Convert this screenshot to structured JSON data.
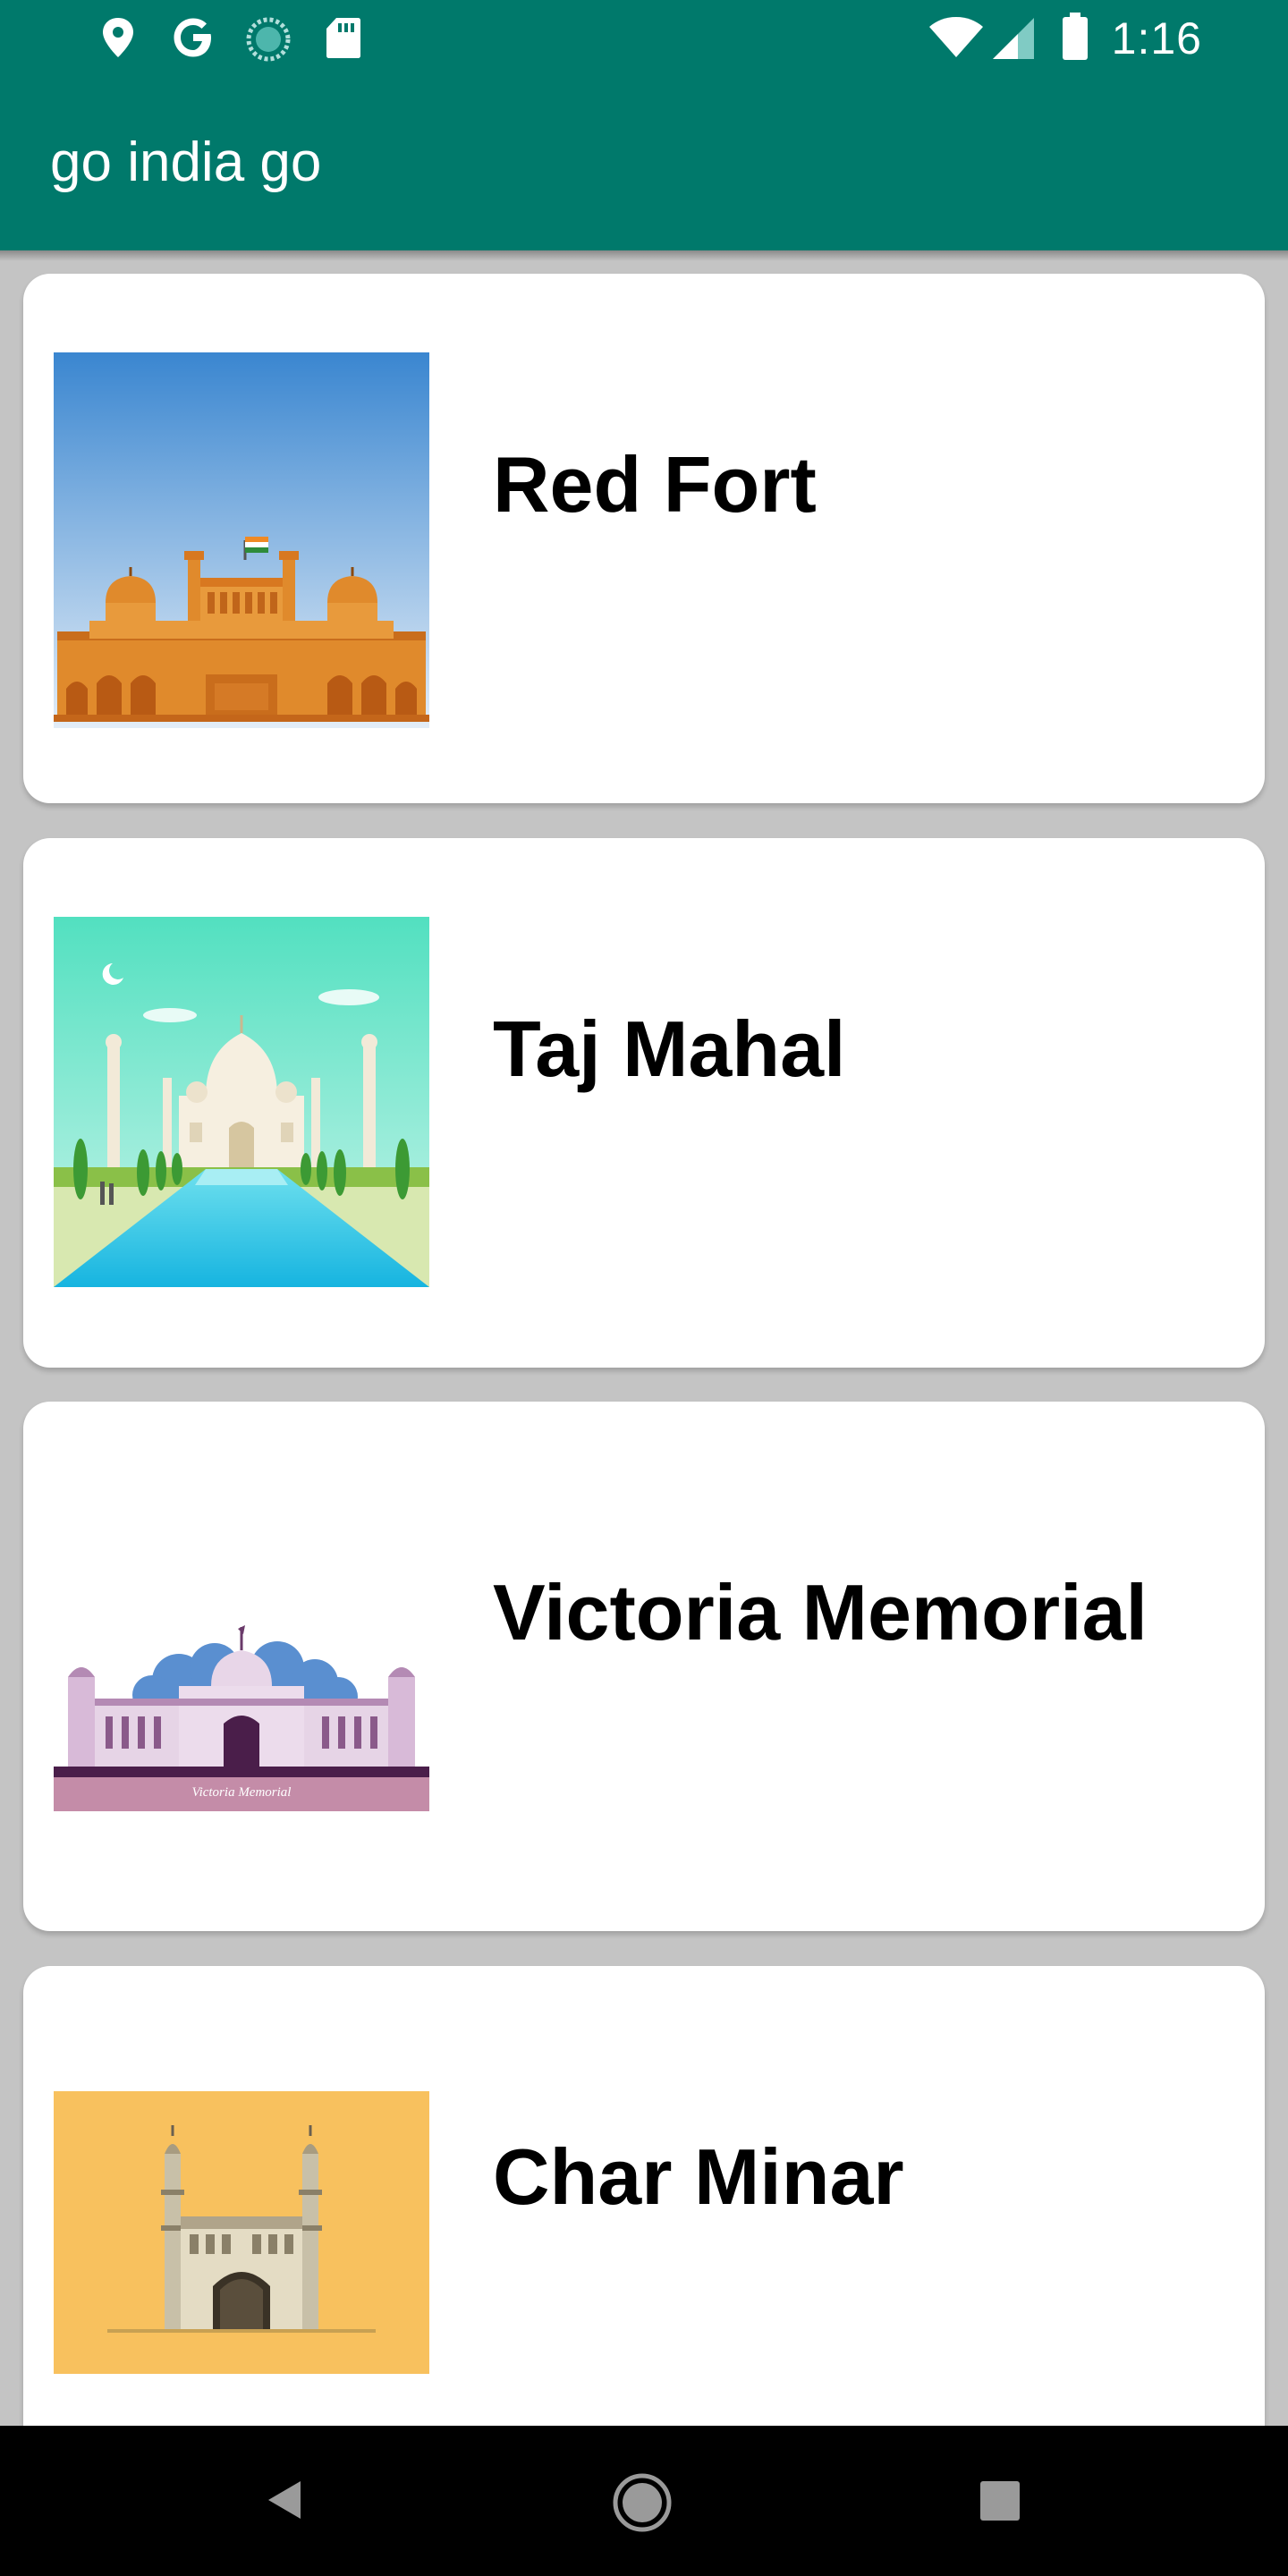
{
  "status_bar": {
    "time": "1:16",
    "icons": [
      "location-icon",
      "google-icon",
      "sync-icon",
      "sd-card-icon",
      "wifi-icon",
      "signal-icon",
      "battery-icon"
    ]
  },
  "app_bar": {
    "title": "go india go",
    "color": "#00796b"
  },
  "monuments": [
    {
      "name": "Red Fort",
      "image": "red-fort-illustration"
    },
    {
      "name": "Taj Mahal",
      "image": "taj-mahal-illustration"
    },
    {
      "name": "Victoria Memorial",
      "image": "victoria-memorial-illustration",
      "image_caption": "Victoria Memorial"
    },
    {
      "name": "Char Minar",
      "image": "char-minar-illustration"
    }
  ],
  "nav_bar": {
    "buttons": [
      "back-icon",
      "home-icon",
      "recents-icon"
    ]
  }
}
